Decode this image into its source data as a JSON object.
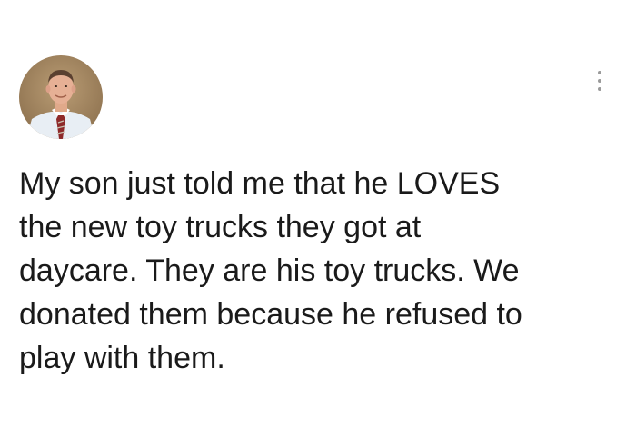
{
  "post": {
    "avatar_icon": "profile-photo",
    "menu_icon": "more-vertical-icon",
    "text": "My son just told me that he LOVES\nthe new toy trucks they got at\ndaycare. They are his toy trucks. We\ndonated them because he refused to\nplay with them."
  },
  "colors": {
    "background": "#ffffff",
    "text": "#1a1a1a",
    "menu_dots": "#9a9a9a"
  }
}
